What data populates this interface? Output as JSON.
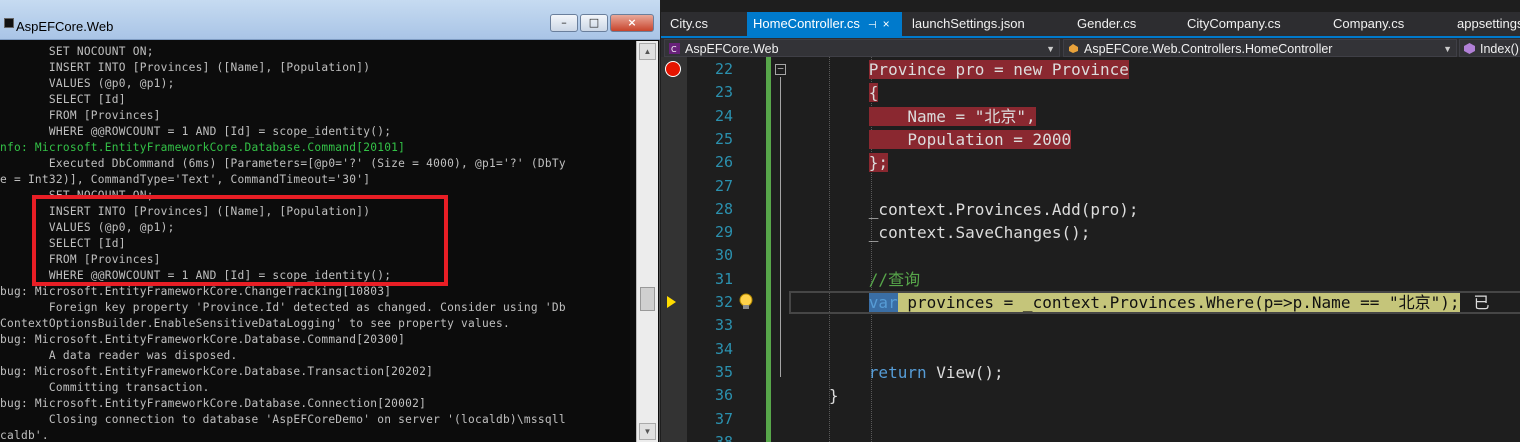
{
  "console": {
    "title": "AspEFCore.Web",
    "buttons": {
      "minimize": "–",
      "maximize": "□",
      "close": "×"
    },
    "lines": [
      {
        "text": "       SET NOCOUNT ON;",
        "kind": "normal"
      },
      {
        "text": "       INSERT INTO [Provinces] ([Name], [Population])",
        "kind": "normal"
      },
      {
        "text": "       VALUES (@p0, @p1);",
        "kind": "normal"
      },
      {
        "text": "       SELECT [Id]",
        "kind": "normal"
      },
      {
        "text": "       FROM [Provinces]",
        "kind": "normal"
      },
      {
        "text": "       WHERE @@ROWCOUNT = 1 AND [Id] = scope_identity();",
        "kind": "normal"
      },
      {
        "text": "nfo: Microsoft.EntityFrameworkCore.Database.Command[20101]",
        "kind": "info"
      },
      {
        "text": "       Executed DbCommand (6ms) [Parameters=[@p0='?' (Size = 4000), @p1='?' (DbTy",
        "kind": "normal"
      },
      {
        "text": "e = Int32)], CommandType='Text', CommandTimeout='30']",
        "kind": "normal"
      },
      {
        "text": "       SET NOCOUNT ON;",
        "kind": "normal"
      },
      {
        "text": "       INSERT INTO [Provinces] ([Name], [Population])",
        "kind": "normal"
      },
      {
        "text": "       VALUES (@p0, @p1);",
        "kind": "normal"
      },
      {
        "text": "       SELECT [Id]",
        "kind": "normal"
      },
      {
        "text": "       FROM [Provinces]",
        "kind": "normal"
      },
      {
        "text": "       WHERE @@ROWCOUNT = 1 AND [Id] = scope_identity();",
        "kind": "normal"
      },
      {
        "text": "bug: Microsoft.EntityFrameworkCore.ChangeTracking[10803]",
        "kind": "normal"
      },
      {
        "text": "       Foreign key property 'Province.Id' detected as changed. Consider using 'Db",
        "kind": "normal"
      },
      {
        "text": "ContextOptionsBuilder.EnableSensitiveDataLogging' to see property values.",
        "kind": "normal"
      },
      {
        "text": "bug: Microsoft.EntityFrameworkCore.Database.Command[20300]",
        "kind": "normal"
      },
      {
        "text": "       A data reader was disposed.",
        "kind": "normal"
      },
      {
        "text": "bug: Microsoft.EntityFrameworkCore.Database.Transaction[20202]",
        "kind": "normal"
      },
      {
        "text": "       Committing transaction.",
        "kind": "normal"
      },
      {
        "text": "bug: Microsoft.EntityFrameworkCore.Database.Connection[20002]",
        "kind": "normal"
      },
      {
        "text": "       Closing connection to database 'AspEFCoreDemo' on server '(localdb)\\mssqll",
        "kind": "normal"
      },
      {
        "text": "caldb'.",
        "kind": "normal"
      }
    ]
  },
  "tabs": [
    {
      "label": "City.cs",
      "active": false
    },
    {
      "label": "HomeController.cs",
      "active": true,
      "pin": "⊣",
      "close": "×"
    },
    {
      "label": "launchSettings.json",
      "active": false
    },
    {
      "label": "Gender.cs",
      "active": false
    },
    {
      "label": "CityCompany.cs",
      "active": false
    },
    {
      "label": "Company.cs",
      "active": false
    },
    {
      "label": "appsettings",
      "active": false
    }
  ],
  "navbar": {
    "project": "AspEFCore.Web",
    "class": "AspEFCore.Web.Controllers.HomeController",
    "member": "Index()"
  },
  "editor": {
    "lines": [
      {
        "num": "22",
        "breakpoint": true,
        "tokens": [
          {
            "t": "Province pro = ",
            "c": ""
          },
          {
            "t": "new",
            "c": ""
          },
          {
            "t": " Province",
            "c": ""
          }
        ],
        "bp_bg": true,
        "indent": 8
      },
      {
        "num": "23",
        "tokens": [
          {
            "t": "{",
            "c": ""
          }
        ],
        "bp_bg": true,
        "indent": 8
      },
      {
        "num": "24",
        "tokens": [
          {
            "t": "    Name = ",
            "c": ""
          },
          {
            "t": "\"北京\"",
            "c": ""
          },
          {
            "t": ",",
            "c": ""
          }
        ],
        "bp_bg": true,
        "indent": 8
      },
      {
        "num": "25",
        "tokens": [
          {
            "t": "    Population = 2000",
            "c": ""
          }
        ],
        "bp_bg": true,
        "indent": 8
      },
      {
        "num": "26",
        "tokens": [
          {
            "t": "};",
            "c": ""
          }
        ],
        "bp_bg": true,
        "indent": 8
      },
      {
        "num": "27",
        "tokens": []
      },
      {
        "num": "28",
        "tokens": [
          {
            "t": "_context.Provinces.Add(pro);",
            "c": ""
          }
        ],
        "indent": 8
      },
      {
        "num": "29",
        "tokens": [
          {
            "t": "_context.SaveChanges();",
            "c": ""
          }
        ],
        "indent": 8
      },
      {
        "num": "30",
        "tokens": []
      },
      {
        "num": "31",
        "tokens": [
          {
            "t": "//查询",
            "c": "cmt"
          }
        ],
        "indent": 8
      },
      {
        "num": "32",
        "exec": true,
        "tokens": [
          {
            "t": "var",
            "c": "kw-sel"
          },
          {
            "t": " provinces = _context.Provinces.Where(p=>p.Name == \"北京\");",
            "c": ""
          }
        ],
        "indent": 8,
        "trail": "已"
      },
      {
        "num": "33",
        "tokens": []
      },
      {
        "num": "34",
        "tokens": []
      },
      {
        "num": "35",
        "tokens": [
          {
            "t": "return",
            "c": "kw"
          },
          {
            "t": " View();",
            "c": ""
          }
        ],
        "indent": 8
      },
      {
        "num": "36",
        "tokens": [
          {
            "t": "}",
            "c": ""
          }
        ],
        "indent": 4
      },
      {
        "num": "37",
        "tokens": []
      },
      {
        "num": "38",
        "tokens": []
      }
    ]
  },
  "colors": {
    "accent": "#007acc",
    "breakpoint": "#e51400",
    "exec_arrow": "#ffdc00",
    "console_info": "#33c247",
    "highlight_box": "#e81e25"
  },
  "icons": [
    "app-icon",
    "breakpoint-icon",
    "execution-arrow-icon",
    "lightbulb-icon",
    "pin-icon",
    "close-icon",
    "fold-collapse-icon"
  ]
}
